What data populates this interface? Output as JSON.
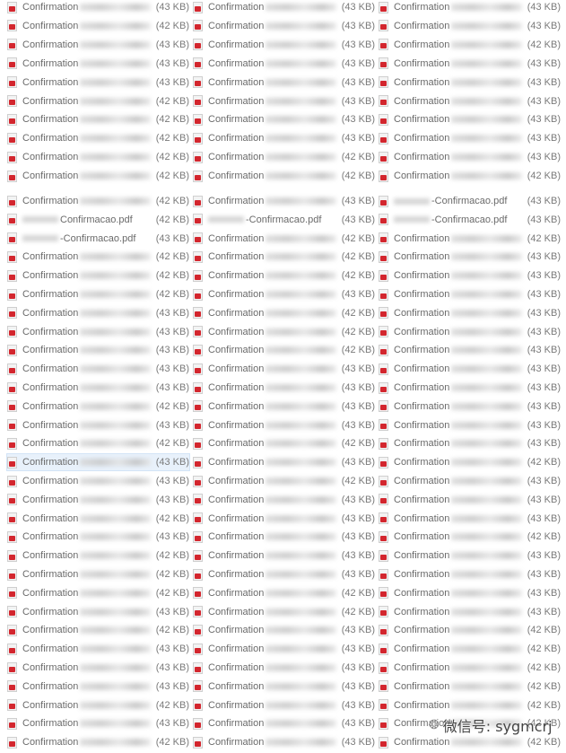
{
  "file_label": "Confirmation",
  "selected_index": [
    24,
    0
  ],
  "columns": 3,
  "blocks": [
    {
      "rows": [
        [
          [
            "Confirmation",
            "(43 KB)"
          ],
          [
            "Confirmation",
            "(43 KB)"
          ],
          [
            "Confirmation",
            "(43 KB)"
          ]
        ],
        [
          [
            "Confirmation",
            "(42 KB)"
          ],
          [
            "Confirmation",
            "(43 KB)"
          ],
          [
            "Confirmation",
            "(43 KB)"
          ]
        ],
        [
          [
            "Confirmation",
            "(43 KB)"
          ],
          [
            "Confirmation",
            "(43 KB)"
          ],
          [
            "Confirmation",
            "(42 KB)"
          ]
        ],
        [
          [
            "Confirmation",
            "(43 KB)"
          ],
          [
            "Confirmation",
            "(43 KB)"
          ],
          [
            "Confirmation",
            "(43 KB)"
          ]
        ],
        [
          [
            "Confirmation",
            "(43 KB)"
          ],
          [
            "Confirmation",
            "(43 KB)"
          ],
          [
            "Confirmation",
            "(43 KB)"
          ]
        ],
        [
          [
            "Confirmation",
            "(42 KB)"
          ],
          [
            "Confirmation",
            "(43 KB)"
          ],
          [
            "Confirmation",
            "(43 KB)"
          ]
        ],
        [
          [
            "Confirmation",
            "(42 KB)"
          ],
          [
            "Confirmation",
            "(43 KB)"
          ],
          [
            "Confirmation",
            "(43 KB)"
          ]
        ],
        [
          [
            "Confirmation",
            "(42 KB)"
          ],
          [
            "Confirmation",
            "(43 KB)"
          ],
          [
            "Confirmation",
            "(43 KB)"
          ]
        ],
        [
          [
            "Confirmation",
            "(42 KB)"
          ],
          [
            "Confirmation",
            "(42 KB)"
          ],
          [
            "Confirmation",
            "(43 KB)"
          ]
        ],
        [
          [
            "Confirmation",
            "(42 KB)"
          ],
          [
            "Confirmation",
            "(42 KB)"
          ],
          [
            "Confirmation",
            "(42 KB)"
          ]
        ]
      ]
    },
    {
      "rows": [
        [
          [
            "Confirmation",
            "(42 KB)"
          ],
          [
            "Confirmation",
            "(43 KB)"
          ],
          [
            "-Confirmacao.pdf",
            "(43 KB)"
          ]
        ],
        [
          [
            "Confirmacao.pdf",
            "(42 KB)"
          ],
          [
            "-Confirmacao.pdf",
            "(43 KB)"
          ],
          [
            "-Confirmacao.pdf",
            "(43 KB)"
          ]
        ],
        [
          [
            "-Confirmacao.pdf",
            "(43 KB)"
          ],
          [
            "Confirmation",
            "(42 KB)"
          ],
          [
            "Confirmation",
            "(42 KB)"
          ]
        ],
        [
          [
            "Confirmation",
            "(42 KB)"
          ],
          [
            "Confirmation",
            "(42 KB)"
          ],
          [
            "Confirmation",
            "(43 KB)"
          ]
        ],
        [
          [
            "Confirmation",
            "(42 KB)"
          ],
          [
            "Confirmation",
            "(42 KB)"
          ],
          [
            "Confirmation",
            "(43 KB)"
          ]
        ],
        [
          [
            "Confirmation",
            "(42 KB)"
          ],
          [
            "Confirmation",
            "(43 KB)"
          ],
          [
            "Confirmation",
            "(43 KB)"
          ]
        ],
        [
          [
            "Confirmation",
            "(43 KB)"
          ],
          [
            "Confirmation",
            "(42 KB)"
          ],
          [
            "Confirmation",
            "(43 KB)"
          ]
        ],
        [
          [
            "Confirmation",
            "(43 KB)"
          ],
          [
            "Confirmation",
            "(42 KB)"
          ],
          [
            "Confirmation",
            "(43 KB)"
          ]
        ],
        [
          [
            "Confirmation",
            "(43 KB)"
          ],
          [
            "Confirmation",
            "(42 KB)"
          ],
          [
            "Confirmation",
            "(43 KB)"
          ]
        ],
        [
          [
            "Confirmation",
            "(43 KB)"
          ],
          [
            "Confirmation",
            "(43 KB)"
          ],
          [
            "Confirmation",
            "(43 KB)"
          ]
        ],
        [
          [
            "Confirmation",
            "(43 KB)"
          ],
          [
            "Confirmation",
            "(43 KB)"
          ],
          [
            "Confirmation",
            "(43 KB)"
          ]
        ],
        [
          [
            "Confirmation",
            "(42 KB)"
          ],
          [
            "Confirmation",
            "(43 KB)"
          ],
          [
            "Confirmation",
            "(43 KB)"
          ]
        ],
        [
          [
            "Confirmation",
            "(43 KB)"
          ],
          [
            "Confirmation",
            "(43 KB)"
          ],
          [
            "Confirmation",
            "(43 KB)"
          ]
        ],
        [
          [
            "Confirmation",
            "(42 KB)"
          ],
          [
            "Confirmation",
            "(42 KB)"
          ],
          [
            "Confirmation",
            "(43 KB)"
          ]
        ],
        [
          [
            "Confirmation",
            "(43 KB)"
          ],
          [
            "Confirmation",
            "(43 KB)"
          ],
          [
            "Confirmation",
            "(42 KB)"
          ]
        ],
        [
          [
            "Confirmation",
            "(43 KB)"
          ],
          [
            "Confirmation",
            "(42 KB)"
          ],
          [
            "Confirmation",
            "(43 KB)"
          ]
        ],
        [
          [
            "Confirmation",
            "(43 KB)"
          ],
          [
            "Confirmation",
            "(43 KB)"
          ],
          [
            "Confirmation",
            "(43 KB)"
          ]
        ],
        [
          [
            "Confirmation",
            "(42 KB)"
          ],
          [
            "Confirmation",
            "(43 KB)"
          ],
          [
            "Confirmation",
            "(43 KB)"
          ]
        ],
        [
          [
            "Confirmation",
            "(43 KB)"
          ],
          [
            "Confirmation",
            "(43 KB)"
          ],
          [
            "Confirmation",
            "(42 KB)"
          ]
        ],
        [
          [
            "Confirmation",
            "(42 KB)"
          ],
          [
            "Confirmation",
            "(43 KB)"
          ],
          [
            "Confirmation",
            "(43 KB)"
          ]
        ],
        [
          [
            "Confirmation",
            "(42 KB)"
          ],
          [
            "Confirmation",
            "(43 KB)"
          ],
          [
            "Confirmation",
            "(43 KB)"
          ]
        ],
        [
          [
            "Confirmation",
            "(42 KB)"
          ],
          [
            "Confirmation",
            "(42 KB)"
          ],
          [
            "Confirmation",
            "(43 KB)"
          ]
        ],
        [
          [
            "Confirmation",
            "(43 KB)"
          ],
          [
            "Confirmation",
            "(42 KB)"
          ],
          [
            "Confirmation",
            "(43 KB)"
          ]
        ],
        [
          [
            "Confirmation",
            "(42 KB)"
          ],
          [
            "Confirmation",
            "(43 KB)"
          ],
          [
            "Confirmation",
            "(42 KB)"
          ]
        ],
        [
          [
            "Confirmation",
            "(43 KB)"
          ],
          [
            "Confirmation",
            "(43 KB)"
          ],
          [
            "Confirmation",
            "(42 KB)"
          ]
        ],
        [
          [
            "Confirmation",
            "(43 KB)"
          ],
          [
            "Confirmation",
            "(43 KB)"
          ],
          [
            "Confirmation",
            "(42 KB)"
          ]
        ],
        [
          [
            "Confirmation",
            "(43 KB)"
          ],
          [
            "Confirmation",
            "(43 KB)"
          ],
          [
            "Confirmation",
            "(42 KB)"
          ]
        ],
        [
          [
            "Confirmation",
            "(42 KB)"
          ],
          [
            "Confirmation",
            "(43 KB)"
          ],
          [
            "Confirmation",
            "(42 KB)"
          ]
        ],
        [
          [
            "Confirmation",
            "(43 KB)"
          ],
          [
            "Confirmation",
            "(43 KB)"
          ],
          [
            "Confirmation",
            "(42 KB)"
          ]
        ],
        [
          [
            "Confirmation",
            "(42 KB)"
          ],
          [
            "Confirmation",
            "(43 KB)"
          ],
          [
            "Confirmation",
            "(42 KB)"
          ]
        ]
      ]
    }
  ],
  "watermark": {
    "text": "微信号: sygmcrj",
    "icon": "wechat-icon"
  },
  "colors": {
    "pdf_icon": "#d3262e",
    "selected_bg": "#e8f1fb",
    "text": "#6a6a6a"
  }
}
